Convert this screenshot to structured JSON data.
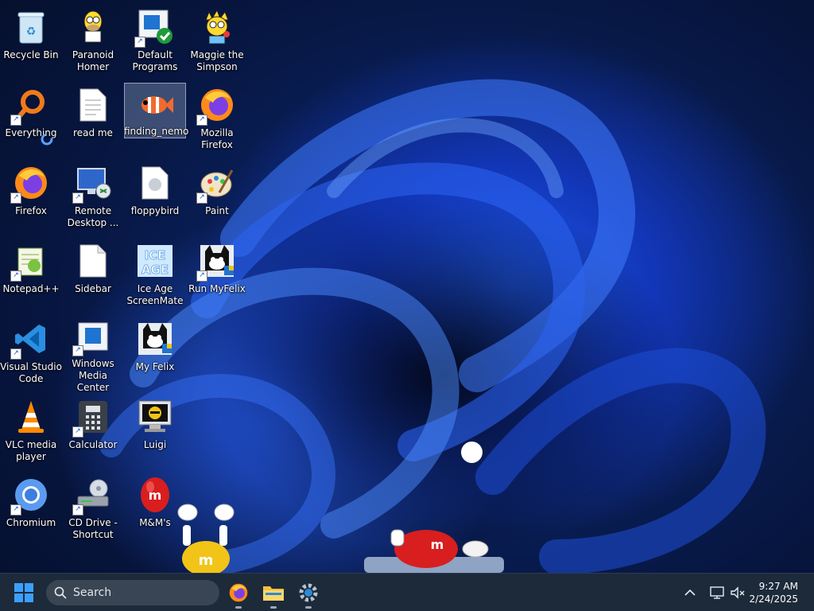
{
  "desktop": {
    "icons": [
      {
        "label": "Recycle Bin",
        "icon": "recycle-bin-icon"
      },
      {
        "label": "Paranoid Homer",
        "icon": "homer-icon"
      },
      {
        "label": "Default Programs",
        "icon": "default-programs-icon"
      },
      {
        "label": "Maggie the Simpson",
        "icon": "maggie-icon"
      },
      {
        "label": "Everything",
        "icon": "everything-search-icon"
      },
      {
        "label": "read me",
        "icon": "text-file-icon"
      },
      {
        "label": "finding_nemo",
        "icon": "nemo-icon"
      },
      {
        "label": "Mozilla Firefox",
        "icon": "firefox-icon"
      },
      {
        "label": "Firefox",
        "icon": "firefox-icon"
      },
      {
        "label": "Remote Desktop ...",
        "icon": "remote-desktop-icon"
      },
      {
        "label": "floppybird",
        "icon": "file-icon"
      },
      {
        "label": "Paint",
        "icon": "paint-palette-icon"
      },
      {
        "label": "Notepad++",
        "icon": "notepadpp-icon"
      },
      {
        "label": "Sidebar",
        "icon": "blank-file-icon"
      },
      {
        "label": "Ice Age ScreenMate",
        "icon": "ice-age-icon"
      },
      {
        "label": "Run MyFelix",
        "icon": "felix-cat-icon"
      },
      {
        "label": "Visual Studio Code",
        "icon": "vscode-icon"
      },
      {
        "label": "Windows Media Center",
        "icon": "media-center-icon"
      },
      {
        "label": "My Felix",
        "icon": "felix-cat-icon"
      },
      {
        "label": "VLC media player",
        "icon": "vlc-cone-icon"
      },
      {
        "label": "Calculator",
        "icon": "calculator-icon"
      },
      {
        "label": "Luigi",
        "icon": "luigi-monitor-icon"
      },
      {
        "label": "Chromium",
        "icon": "chromium-icon"
      },
      {
        "label": "CD Drive - Shortcut",
        "icon": "cd-drive-icon"
      },
      {
        "label": "M&M's",
        "icon": "mms-candy-icon"
      }
    ]
  },
  "taskbar": {
    "search_placeholder": "Search",
    "pinned": [
      "firefox-icon",
      "file-explorer-icon",
      "settings-gear-icon"
    ],
    "tray_icons": [
      "chevron-up-icon",
      "network-icon",
      "volume-muted-icon"
    ],
    "time": "9:27 AM",
    "date": "2/24/2025"
  },
  "colors": {
    "accent": "#3aa0ff",
    "taskbar": "#1d2a3a",
    "mms_red": "#d81e1e",
    "mms_yellow": "#f2c417"
  }
}
